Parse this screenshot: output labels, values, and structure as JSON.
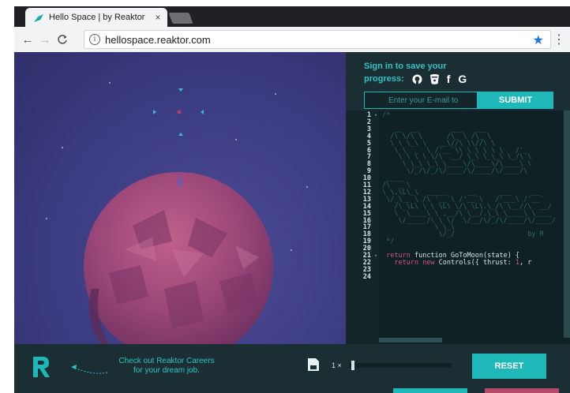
{
  "browser": {
    "tab_title": "Hello Space | by Reaktor",
    "tab_close": "×",
    "url": "hellospace.reaktor.com",
    "info_glyph": "i",
    "star_glyph": "★",
    "menu_glyph": "⋮",
    "back_glyph": "←",
    "forward_glyph": "→",
    "reload_glyph": "C"
  },
  "panel": {
    "signin_line1": "Sign in to save your",
    "signin_line2": "progress:",
    "social_icons": [
      "github-icon",
      "bitbucket-icon",
      "facebook-icon",
      "google-icon"
    ],
    "social_glyph_fb": "f",
    "social_glyph_g": "G",
    "email_placeholder": "Enter your E-mail to",
    "submit_label": "SUBMIT"
  },
  "editor": {
    "line_numbers": [
      "1",
      "2",
      "3",
      "4",
      "5",
      "6",
      "7",
      "8",
      "9",
      "10",
      "11",
      "12",
      "13",
      "14",
      "15",
      "16",
      "17",
      "18",
      "19",
      "20",
      "21",
      "22",
      "23",
      "24"
    ],
    "art_lines": [
      "/*",
      "",
      "   __  __        ___   ___",
      "  /\\ \\/\\ \\      /\\_ \\ /\\_ \\",
      "  \\ \\ \\_\\ \\   __\\//\\ \\\\//\\ \\",
      "   \\ \\  _  \\ /'__`\\\\ \\ \\ \\ \\ \\   /'_",
      "    \\ \\ \\ \\ \\/\\  __/ \\_\\ \\_\\_\\ \\_/\\ \\",
      "     \\ \\_\\ \\_\\ \\____\\/\\____\\/\\____\\ \\",
      "      \\/_/\\/_/\\/____/\\/____/\\/____/\\",
      " ____",
      "/\\  _`\\",
      "\\ \\,\\L\\_\\  _____     __      ___     __",
      " \\/_\\__ \\ /\\ '__`\\ /'__`\\   /'___\\ /'__`",
      "   /\\ \\L\\ \\ \\ \\L\\ \\/\\ \\L\\.\\_/\\ \\__//\\  __/",
      "   \\ `\\____\\ \\ ,__/\\ \\__/.\\_\\ \\____\\ \\____",
      "    \\/_____/\\ \\ \\/  \\/__/\\/_/\\/____/\\/____/",
      "             \\ \\_\\",
      "              \\/_/                  by R",
      " */",
      ""
    ],
    "line21_kw": "return",
    "line21_text": " function ",
    "line21_fn": "GoToMoon",
    "line21_rest": "(state) {",
    "line22_kw": "return new",
    "line22_text": " Controls({ thrust: ",
    "line22_num": "1",
    "line22_rest": ", r"
  },
  "footer": {
    "careers_line1": "Check out Reaktor Careers",
    "careers_line2": "for your dream job.",
    "speed_label": "1 ×",
    "speed_value": 0.02,
    "reset_label": "RESET"
  },
  "colors": {
    "accent": "#1fb8b8",
    "space_bg": "#3c3c82",
    "planet": "#a24a7a",
    "panel_bg": "#1a2e33"
  }
}
